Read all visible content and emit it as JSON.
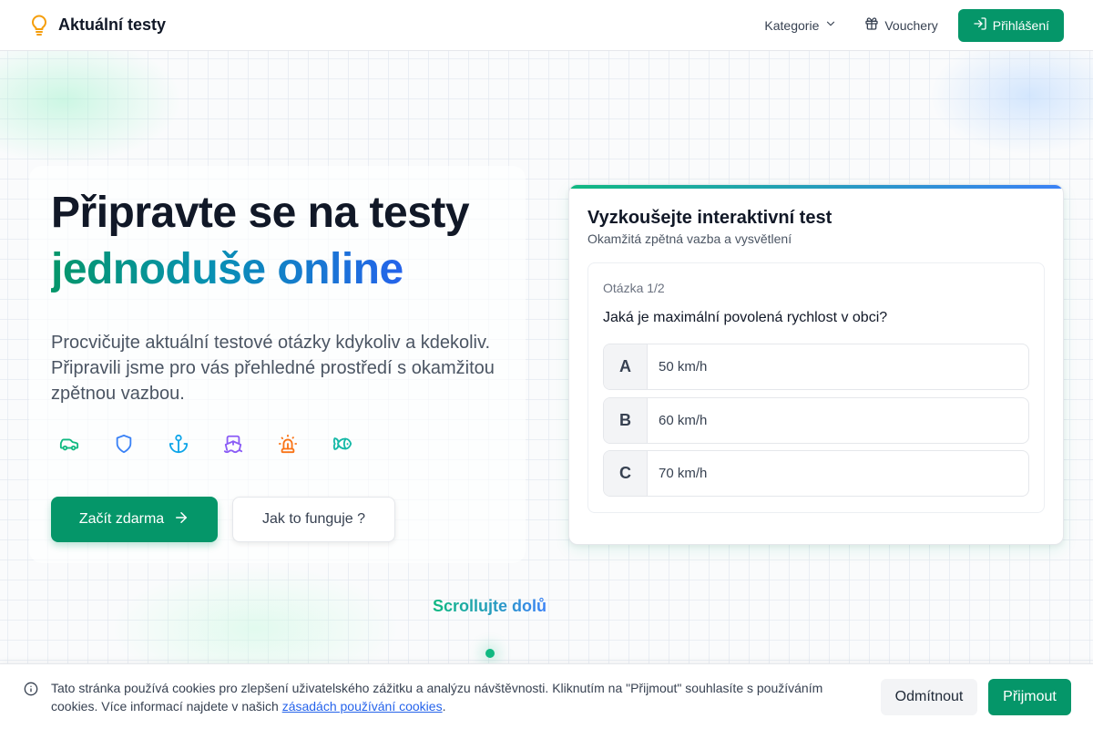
{
  "header": {
    "brand": "Aktuální testy",
    "nav": {
      "categories": "Kategorie",
      "vouchers": "Vouchery",
      "login": "Přihlášení"
    }
  },
  "hero": {
    "title": "Připravte se na testy",
    "title_accent": "jednoduše online",
    "description": "Procvičujte aktuální testové otázky kdykoliv a kdekoliv. Připravili jsme pro vás přehledné prostředí s okamžitou zpětnou vazbou.",
    "category_icons": [
      "car-icon",
      "shield-icon",
      "anchor-icon",
      "ship-icon",
      "siren-icon",
      "fish-icon"
    ],
    "start_button": "Začít zdarma",
    "how_button": "Jak to funguje ?"
  },
  "quiz": {
    "title": "Vyzkoušejte interaktivní test",
    "subtitle": "Okamžitá zpětná vazba a vysvětlení",
    "counter": "Otázka 1/2",
    "question": "Jaká je maximální povolená rychlost v obci?",
    "answers": [
      {
        "letter": "A",
        "text": "50 km/h"
      },
      {
        "letter": "B",
        "text": "60 km/h"
      },
      {
        "letter": "C",
        "text": "70 km/h"
      }
    ]
  },
  "scroll_hint": "Scrollujte dolů",
  "cookies": {
    "text": "Tato stránka používá cookies pro zlepšení uživatelského zážitku a analýzu návštěvnosti. Kliknutím na \"Přijmout\" souhlasíte s používáním cookies. Více informací najdete v našich ",
    "link": "zásadách používání cookies",
    "text_end": ".",
    "decline": "Odmítnout",
    "accept": "Přijmout"
  },
  "colors": {
    "primary": "#059669",
    "accent_blue": "#2563eb",
    "text": "#111827"
  }
}
